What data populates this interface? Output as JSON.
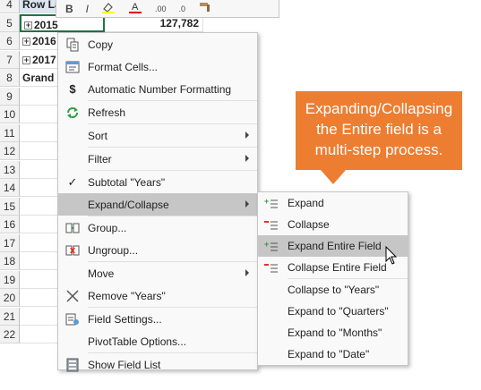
{
  "sheet": {
    "rows": [
      {
        "num": "4",
        "label": "Row La",
        "value": ""
      },
      {
        "num": "5",
        "label": "2015",
        "value": "127,782"
      },
      {
        "num": "6",
        "label": "2016",
        "value": ""
      },
      {
        "num": "7",
        "label": "2017",
        "value": ""
      },
      {
        "num": "8",
        "label": "Grand",
        "value": ""
      },
      {
        "num": "9",
        "label": "",
        "value": ""
      },
      {
        "num": "10",
        "label": "",
        "value": ""
      },
      {
        "num": "11",
        "label": "",
        "value": ""
      },
      {
        "num": "12",
        "label": "",
        "value": ""
      },
      {
        "num": "13",
        "label": "",
        "value": ""
      },
      {
        "num": "14",
        "label": "",
        "value": ""
      },
      {
        "num": "15",
        "label": "",
        "value": ""
      },
      {
        "num": "16",
        "label": "",
        "value": ""
      },
      {
        "num": "17",
        "label": "",
        "value": ""
      },
      {
        "num": "18",
        "label": "",
        "value": ""
      },
      {
        "num": "19",
        "label": "",
        "value": ""
      },
      {
        "num": "20",
        "label": "",
        "value": ""
      },
      {
        "num": "21",
        "label": "",
        "value": ""
      },
      {
        "num": "22",
        "label": "",
        "value": ""
      }
    ],
    "expander_symbol": "+"
  },
  "mini_toolbar": {
    "bold": "B",
    "decimal_increase": ".00",
    "decimal_decrease": ".0"
  },
  "context_menu": {
    "copy": "Copy",
    "format_cells": "Format Cells...",
    "auto_number_format": "Automatic Number Formatting",
    "refresh": "Refresh",
    "sort": "Sort",
    "filter": "Filter",
    "subtotal": "Subtotal \"Years\"",
    "expand_collapse": "Expand/Collapse",
    "group": "Group...",
    "ungroup": "Ungroup...",
    "move": "Move",
    "remove": "Remove \"Years\"",
    "field_settings": "Field Settings...",
    "pivottable_options": "PivotTable Options...",
    "show_field_list": "Show Field List"
  },
  "submenu": {
    "expand": "Expand",
    "collapse": "Collapse",
    "expand_entire_field": "Expand Entire Field",
    "collapse_entire_field": "Collapse Entire Field",
    "collapse_to_years": "Collapse to \"Years\"",
    "expand_to_quarters": "Expand to \"Quarters\"",
    "expand_to_months": "Expand to \"Months\"",
    "expand_to_date": "Expand to \"Date\""
  },
  "callout": {
    "text": "Expanding/Collapsing the Entire field is a multi-step process."
  },
  "colors": {
    "callout": "#ed7d31",
    "highlight": "#c6c6c6",
    "selection_border": "#217346",
    "expand_icon": "#2e9e47",
    "collapse_icon": "#d9362b"
  }
}
